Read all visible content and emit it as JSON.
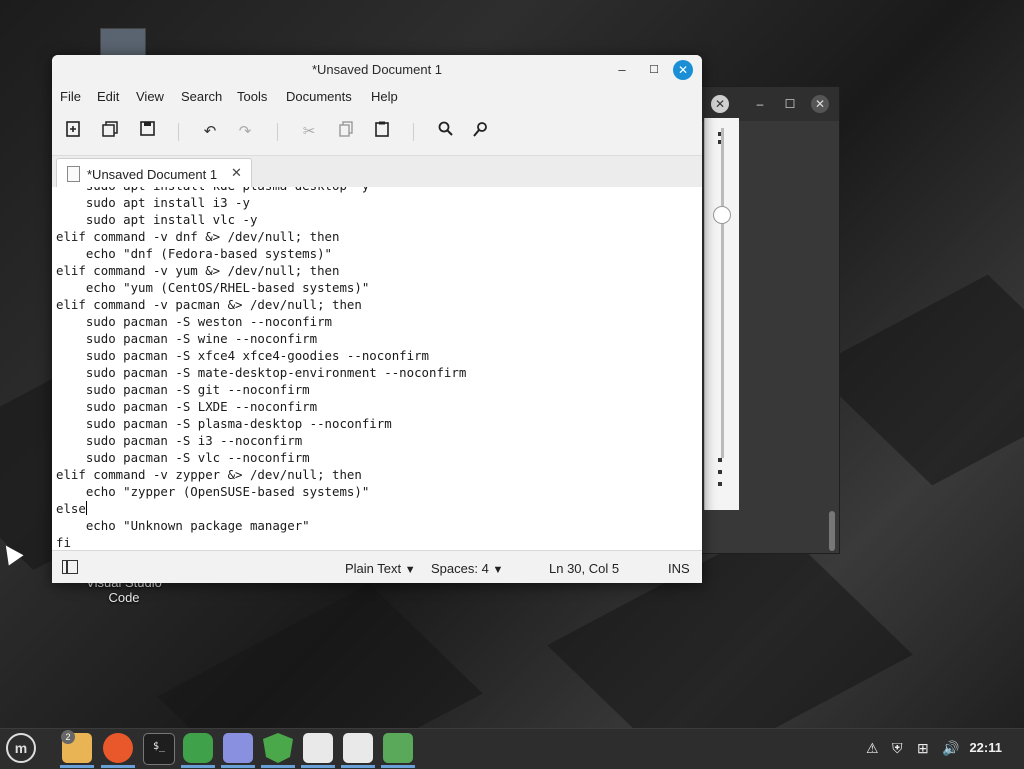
{
  "window": {
    "title": "*Unsaved Document 1",
    "minimize": "–",
    "maximize": "☐",
    "close": "✕"
  },
  "menu": [
    "File",
    "Edit",
    "View",
    "Search",
    "Tools",
    "Documents",
    "Help"
  ],
  "toolbar": {
    "new_icon": "new-document-icon",
    "open_icon": "open-file-icon",
    "save_icon": "save-icon",
    "undo_icon": "undo-icon",
    "redo_icon": "redo-icon",
    "cut_icon": "cut-icon",
    "copy_icon": "copy-icon",
    "paste_icon": "paste-icon",
    "search_icon": "search-icon",
    "replace_icon": "find-replace-icon"
  },
  "tab": {
    "label": "*Unsaved Document 1",
    "close": "✕"
  },
  "code_lines": [
    "    sudo apt install kde-plasma-desktop -y",
    "    sudo apt install i3 -y",
    "    sudo apt install vlc -y",
    "elif command -v dnf &> /dev/null; then",
    "    echo \"dnf (Fedora-based systems)\"",
    "elif command -v yum &> /dev/null; then",
    "    echo \"yum (CentOS/RHEL-based systems)\"",
    "elif command -v pacman &> /dev/null; then",
    "    sudo pacman -S weston --noconfirm",
    "    sudo pacman -S wine --noconfirm",
    "    sudo pacman -S xfce4 xfce4-goodies --noconfirm",
    "    sudo pacman -S mate-desktop-environment --noconfirm",
    "    sudo pacman -S git --noconfirm",
    "    sudo pacman -S LXDE --noconfirm",
    "    sudo pacman -S plasma-desktop --noconfirm",
    "    sudo pacman -S i3 --noconfirm",
    "    sudo pacman -S vlc --noconfirm",
    "elif command -v zypper &> /dev/null; then",
    "    echo \"zypper (OpenSUSE-based systems)\"",
    "else",
    "    echo \"Unknown package manager\"",
    "fi"
  ],
  "status": {
    "language": "Plain Text",
    "spaces": "Spaces: 4",
    "position": "Ln 30, Col 5",
    "mode": "INS",
    "dropdown_arrow": "▼"
  },
  "desktop": {
    "icon_label_line1": "Visual Studio",
    "icon_label_line2": "Code"
  },
  "taskbar": {
    "menu_icon": "linux-mint-menu-icon",
    "files_badge": "2",
    "clock": "22:11"
  },
  "colors": {
    "accent": "#1b8fd6",
    "taskbar": "#2d2d2d"
  }
}
